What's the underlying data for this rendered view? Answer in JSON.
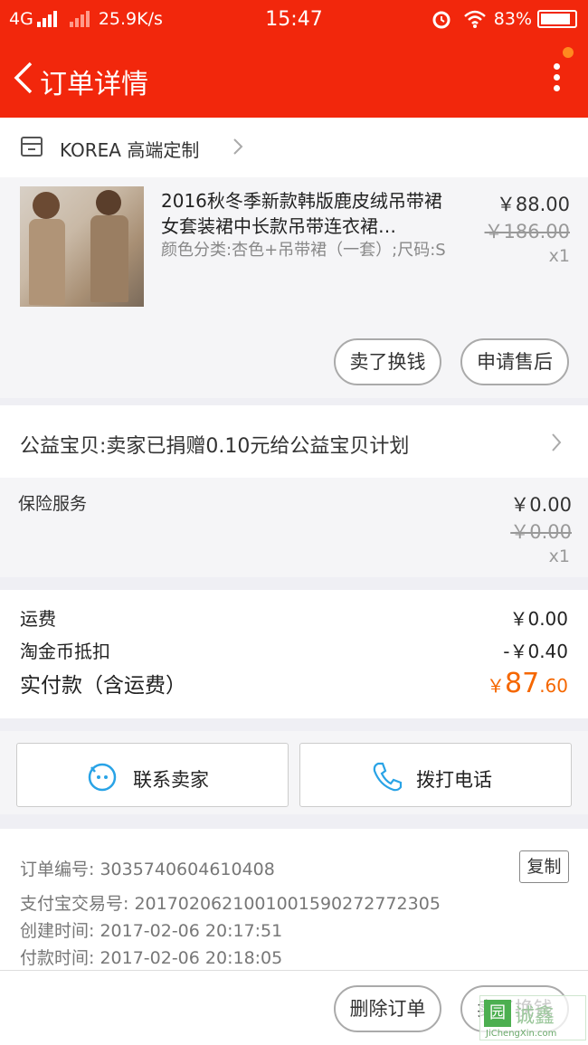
{
  "status_bar": {
    "network": "4G",
    "speed": "25.9K/s",
    "time": "15:47",
    "battery": "83%"
  },
  "nav": {
    "title": "订单详情"
  },
  "shop": {
    "name": "KOREA 高端定制"
  },
  "item": {
    "title": "2016秋冬季新款韩版鹿皮绒吊带裙女套装裙中长款吊带连衣裙…",
    "spec": "颜色分类:杏色+吊带裙（一套）;尺码:S",
    "price": "￥88.00",
    "original_price": "￥186.00",
    "quantity": "x1",
    "button_sell": "卖了换钱",
    "button_aftersale": "申请售后"
  },
  "charity": {
    "text": "公益宝贝:卖家已捐赠0.10元给公益宝贝计划"
  },
  "insurance": {
    "label": "保险服务",
    "price": "￥0.00",
    "original_price": "￥0.00",
    "quantity": "x1"
  },
  "totals": {
    "shipping_label": "运费",
    "shipping_value": "￥0.00",
    "coin_label": "淘金币抵扣",
    "coin_value": "-￥0.40",
    "paid_label": "实付款（含运费）",
    "paid_symbol": "￥",
    "paid_int": "87",
    "paid_dec": ".60"
  },
  "contact": {
    "seller_label": "联系卖家",
    "phone_label": "拨打电话"
  },
  "order_info": {
    "order_no": "订单编号: 3035740604610408",
    "alipay_no": "支付宝交易号: 2017020621001001590272772305",
    "created": "创建时间: 2017-02-06 20:17:51",
    "paid": "付款时间: 2017-02-06 20:18:05",
    "copy_label": "复制"
  },
  "footer": {
    "delete_label": "删除订单",
    "sell_label": "卖了换钱"
  },
  "watermark": {
    "text": "诚鑫",
    "sub": "JiChengXin.com",
    "icon": "园"
  },
  "colors": {
    "brand": "#f2270c",
    "price_orange": "#f56700"
  }
}
